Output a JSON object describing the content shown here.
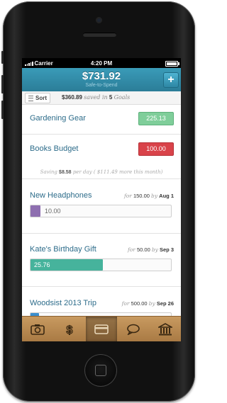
{
  "status_bar": {
    "carrier": "Carrier",
    "time": "4:20 PM"
  },
  "header": {
    "amount": "$731.92",
    "subtitle": "Safe-to-Spend",
    "add_label": "+"
  },
  "sort_bar": {
    "sort_label": "Sort",
    "saved_amount": "$360.89",
    "saved_text": "saved in",
    "goal_count": "5",
    "goals_text": "Goals"
  },
  "budgets": [
    {
      "name": "Gardening Gear",
      "amount": "225.13",
      "status": "positive"
    },
    {
      "name": "Books Budget",
      "amount": "100.00",
      "status": "negative"
    }
  ],
  "saving_line": {
    "prefix": "Saving",
    "amount": "$8.58",
    "per": "per day",
    "paren": "( $111.49 more this month)"
  },
  "goals": [
    {
      "name": "New Headphones",
      "for_label": "for",
      "target": "150.00",
      "by_label": "by",
      "date": "Aug 1",
      "saved": "10.00",
      "progress": 0.07,
      "color": "#8e6fb0"
    },
    {
      "name": "Kate's Birthday Gift",
      "for_label": "for",
      "target": "50.00",
      "by_label": "by",
      "date": "Sep 3",
      "saved": "25.76",
      "progress": 0.515,
      "color": "#46b39c"
    },
    {
      "name": "Woodsist 2013 Trip",
      "for_label": "for",
      "target": "500.00",
      "by_label": "by",
      "date": "Sep 26",
      "saved": "",
      "progress": 0.06,
      "color": "#3a8fcf"
    }
  ],
  "tab_bar": {
    "tabs": [
      "camera-icon",
      "dollar-icon",
      "card-icon",
      "chat-bubble-icon",
      "bank-icon"
    ],
    "active_index": 2
  },
  "colors": {
    "header": "#3a9bb8",
    "title": "#2d6c8a",
    "positive": "#7fce9a",
    "negative": "#d9434a",
    "tab_bar": "#b88a52"
  }
}
